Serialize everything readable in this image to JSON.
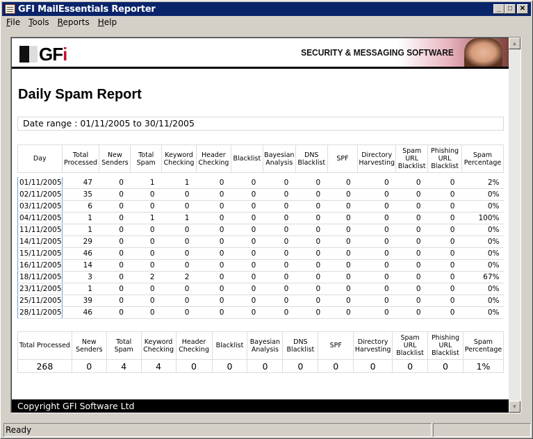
{
  "window": {
    "title": "GFI MailEssentials Reporter",
    "controls": {
      "minimize": "_",
      "maximize": "□",
      "close": "✕"
    }
  },
  "menu": [
    {
      "underline": "F",
      "rest": "ile"
    },
    {
      "underline": "T",
      "rest": "ools"
    },
    {
      "underline": "R",
      "rest": "eports"
    },
    {
      "underline": "H",
      "rest": "elp"
    }
  ],
  "banner": {
    "logo_text": "GF",
    "logo_accent": "i",
    "tagline": "SECURITY & MESSAGING SOFTWARE"
  },
  "report": {
    "title": "Daily Spam Report",
    "date_range": "Date range : 01/11/2005 to 30/11/2005"
  },
  "daily_table": {
    "headers": [
      "Day",
      "Total Processed",
      "New Senders",
      "Total Spam",
      "Keyword Checking",
      "Header Checking",
      "Blacklist",
      "Bayesian Analysis",
      "DNS Blacklist",
      "SPF",
      "Directory Harvesting",
      "Spam URL Blacklist",
      "Phishing URL Blacklist",
      "Spam Percentage"
    ],
    "rows": [
      [
        "01/11/2005",
        "47",
        "0",
        "1",
        "1",
        "0",
        "0",
        "0",
        "0",
        "0",
        "0",
        "0",
        "0",
        "2%"
      ],
      [
        "02/11/2005",
        "35",
        "0",
        "0",
        "0",
        "0",
        "0",
        "0",
        "0",
        "0",
        "0",
        "0",
        "0",
        "0%"
      ],
      [
        "03/11/2005",
        "6",
        "0",
        "0",
        "0",
        "0",
        "0",
        "0",
        "0",
        "0",
        "0",
        "0",
        "0",
        "0%"
      ],
      [
        "04/11/2005",
        "1",
        "0",
        "1",
        "1",
        "0",
        "0",
        "0",
        "0",
        "0",
        "0",
        "0",
        "0",
        "100%"
      ],
      [
        "11/11/2005",
        "1",
        "0",
        "0",
        "0",
        "0",
        "0",
        "0",
        "0",
        "0",
        "0",
        "0",
        "0",
        "0%"
      ],
      [
        "14/11/2005",
        "29",
        "0",
        "0",
        "0",
        "0",
        "0",
        "0",
        "0",
        "0",
        "0",
        "0",
        "0",
        "0%"
      ],
      [
        "15/11/2005",
        "46",
        "0",
        "0",
        "0",
        "0",
        "0",
        "0",
        "0",
        "0",
        "0",
        "0",
        "0",
        "0%"
      ],
      [
        "16/11/2005",
        "14",
        "0",
        "0",
        "0",
        "0",
        "0",
        "0",
        "0",
        "0",
        "0",
        "0",
        "0",
        "0%"
      ],
      [
        "18/11/2005",
        "3",
        "0",
        "2",
        "2",
        "0",
        "0",
        "0",
        "0",
        "0",
        "0",
        "0",
        "0",
        "67%"
      ],
      [
        "23/11/2005",
        "1",
        "0",
        "0",
        "0",
        "0",
        "0",
        "0",
        "0",
        "0",
        "0",
        "0",
        "0",
        "0%"
      ],
      [
        "25/11/2005",
        "39",
        "0",
        "0",
        "0",
        "0",
        "0",
        "0",
        "0",
        "0",
        "0",
        "0",
        "0",
        "0%"
      ],
      [
        "28/11/2005",
        "46",
        "0",
        "0",
        "0",
        "0",
        "0",
        "0",
        "0",
        "0",
        "0",
        "0",
        "0",
        "0%"
      ]
    ]
  },
  "totals_table": {
    "headers": [
      "Total Processed",
      "New Senders",
      "Total Spam",
      "Keyword Checking",
      "Header Checking",
      "Blacklist",
      "Bayesian Analysis",
      "DNS Blacklist",
      "SPF",
      "Directory Harvesting",
      "Spam URL Blacklist",
      "Phishing URL Blacklist",
      "Spam Percentage"
    ],
    "values": [
      "268",
      "0",
      "4",
      "4",
      "0",
      "0",
      "0",
      "0",
      "0",
      "0",
      "0",
      "0",
      "1%"
    ]
  },
  "footer": {
    "copyright": "Copyright GFI Software Ltd"
  },
  "status": {
    "text": "Ready",
    "secondary": ""
  },
  "scrollbar": {
    "up": "▲",
    "down": "▼"
  }
}
